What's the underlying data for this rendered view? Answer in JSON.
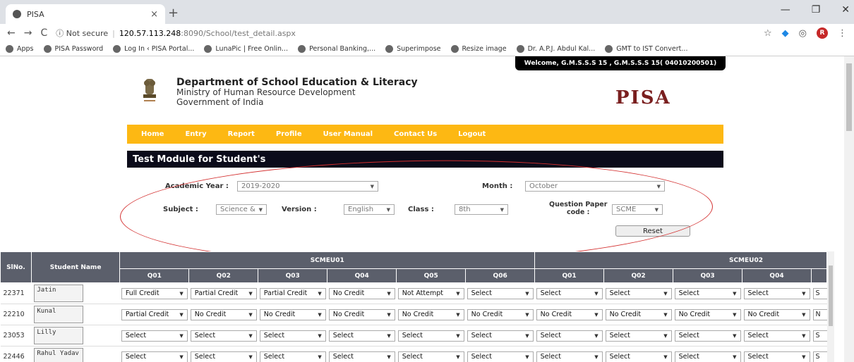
{
  "browser": {
    "tab_title": "PISA",
    "tab_close": "×",
    "new_tab": "+",
    "win_min": "—",
    "win_max": "❐",
    "win_close": "✕",
    "back": "←",
    "forward": "→",
    "reload": "C",
    "security": "ⓘ Not secure",
    "url_host": "120.57.113.248",
    "url_path": ":8090/School/test_detail.aspx",
    "bookmarks": [
      "Apps",
      "PISA Password",
      "Log In ‹ PISA Portal...",
      "LunaPic | Free Onlin...",
      "Personal Banking,...",
      "Superimpose",
      "Resize image",
      "Dr. A.P.J. Abdul Kal...",
      "GMT to IST Convert..."
    ],
    "profile_initial": "R"
  },
  "header": {
    "welcome": "Welcome, G.M.S.S.S 15 , G.M.S.S.S 15( 04010200501)",
    "dept_line1": "Department of School Education & Literacy",
    "dept_line2": "Ministry of Human Resource Development",
    "dept_line3": "Government of India",
    "pisa_logo": "PISA"
  },
  "menu": [
    "Home",
    "Entry",
    "Report",
    "Profile",
    "User Manual",
    "Contact Us",
    "Logout"
  ],
  "module_title": "Test Module for Student's",
  "form": {
    "academic_year_label": "Academic Year :",
    "academic_year_value": "2019-2020",
    "month_label": "Month :",
    "month_value": "October",
    "subject_label": "Subject :",
    "subject_value": "Science &",
    "version_label": "Version :",
    "version_value": "English",
    "class_label": "Class :",
    "class_value": "8th",
    "qp_label_1": "Question Paper",
    "qp_label_2": "code :",
    "qp_value": "SCME",
    "reset": "Reset"
  },
  "table": {
    "col_slno": "SlNo.",
    "col_name": "Student Name",
    "group1": "SCMEU01",
    "group2": "SCMEU02",
    "g1_questions": [
      "Q01",
      "Q02",
      "Q03",
      "Q04",
      "Q05",
      "Q06"
    ],
    "g2_questions": [
      "Q01",
      "Q02",
      "Q03",
      "Q04"
    ],
    "rows": [
      {
        "sl": "22371",
        "name": "Jatin",
        "values": [
          "Full Credit",
          "Partial Credit",
          "Partial Credit",
          "No Credit",
          "Not Attempt",
          "Select",
          "Select",
          "Select",
          "Select",
          "Select"
        ],
        "trail": "S"
      },
      {
        "sl": "22210",
        "name": "Kunal",
        "values": [
          "Partial Credit",
          "No Credit",
          "No Credit",
          "No Credit",
          "No Credit",
          "No Credit",
          "No Credit",
          "No Credit",
          "No Credit",
          "No Credit"
        ],
        "trail": "N"
      },
      {
        "sl": "23053",
        "name": "Lilly",
        "values": [
          "Select",
          "Select",
          "Select",
          "Select",
          "Select",
          "Select",
          "Select",
          "Select",
          "Select",
          "Select"
        ],
        "trail": "S"
      },
      {
        "sl": "22446",
        "name": "Rahul Yadav",
        "values": [
          "Select",
          "Select",
          "Select",
          "Select",
          "Select",
          "Select",
          "Select",
          "Select",
          "Select",
          "Select"
        ],
        "trail": "S"
      }
    ]
  }
}
